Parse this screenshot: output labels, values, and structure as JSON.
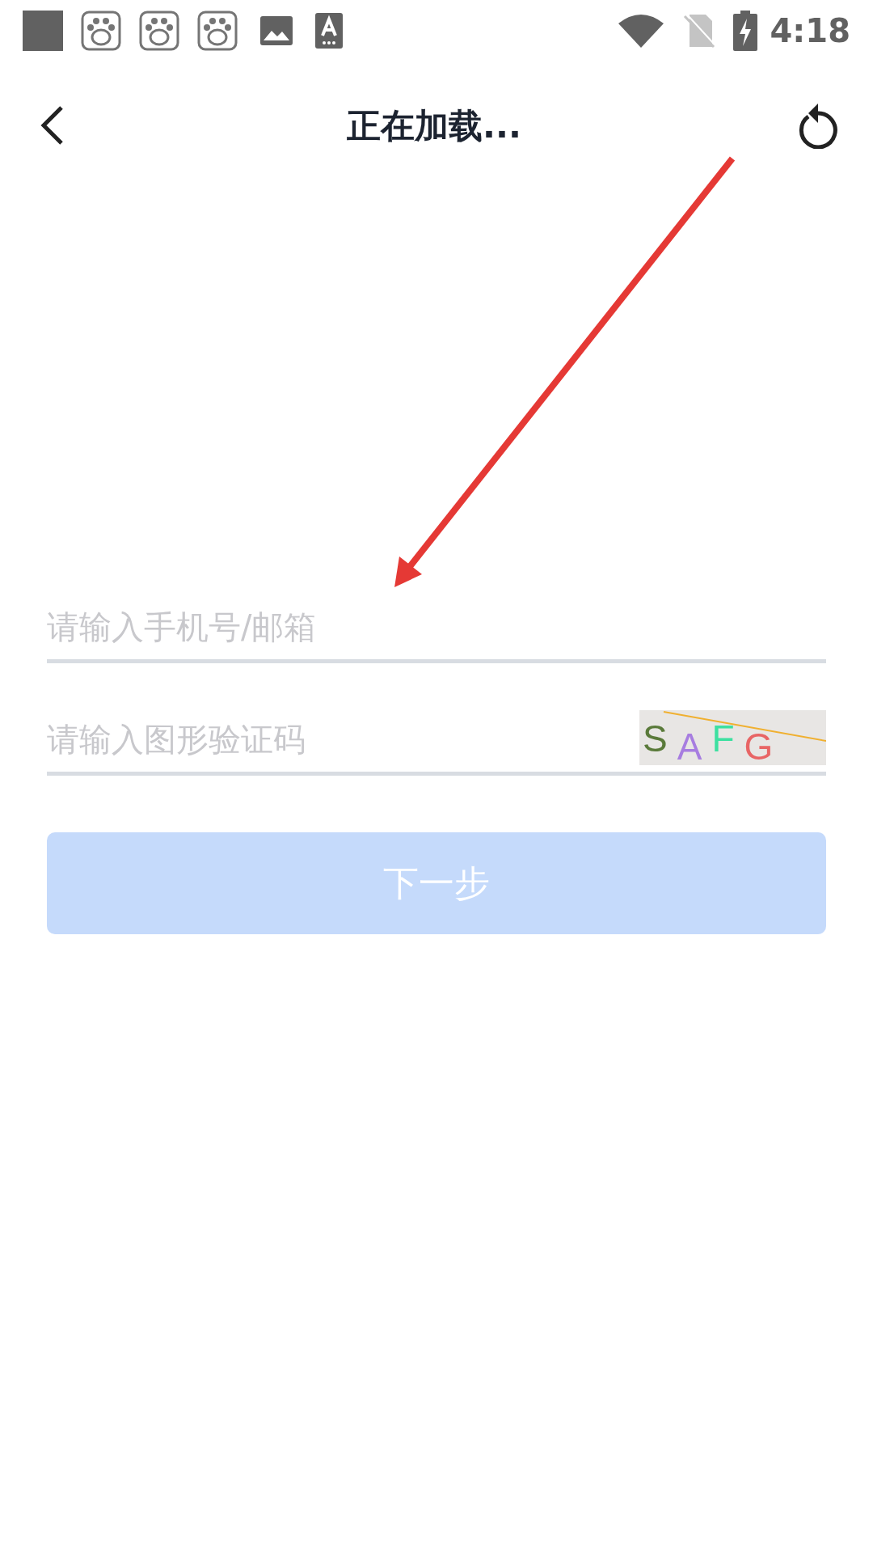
{
  "status_bar": {
    "notifications": [
      {
        "kind": "square"
      },
      {
        "kind": "paw"
      },
      {
        "kind": "paw"
      },
      {
        "kind": "paw"
      },
      {
        "kind": "image"
      },
      {
        "kind": "font"
      }
    ],
    "time": "4:18"
  },
  "header": {
    "title": "正在加载..."
  },
  "form": {
    "fields": [
      {
        "kind": "text",
        "placeholder": "请输入手机号/邮箱"
      },
      {
        "kind": "captcha",
        "placeholder": "请输入图形验证码",
        "captcha": [
          {
            "char": "S",
            "color": "#5a7a3a"
          },
          {
            "char": "A",
            "color": "#a77de0"
          },
          {
            "char": "F",
            "color": "#3de0a0"
          },
          {
            "char": "G",
            "color": "#e86565"
          }
        ]
      }
    ],
    "next_button": {
      "label": "下一步",
      "disabled": true
    }
  },
  "annotation": {
    "kind": "arrow",
    "color": "#e53935"
  }
}
